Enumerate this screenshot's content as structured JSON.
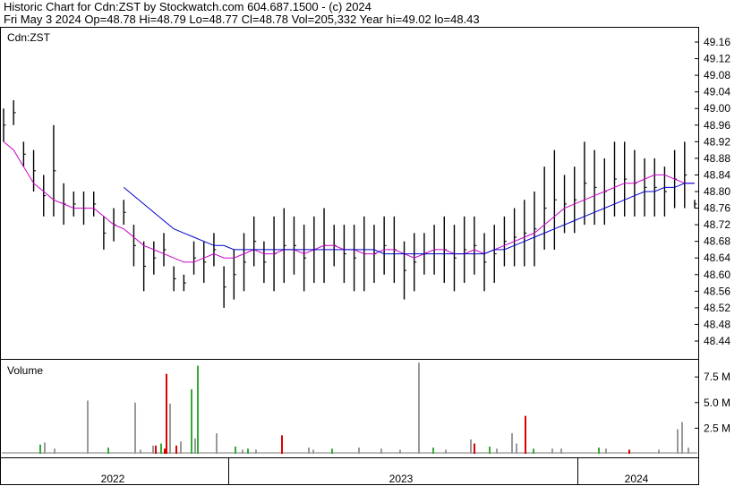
{
  "header": {
    "line1": "Historic Chart for Cdn:ZST by Stockwatch.com 604.687.1500 - (c) 2024",
    "line2": "Fri May  3 2024  Op=48.78  Hi=48.79  Lo=48.77  Cl=48.78  Vol=205,332  Year hi=49.02  lo=48.43"
  },
  "colors": {
    "price_bar": "#000000",
    "ma_short": "#cc00cc",
    "ma_long": "#0000cc",
    "vol_up": "#33aa33",
    "vol_down": "#dd0000",
    "vol_flat": "#999999"
  },
  "chart_data": [
    {
      "type": "ohlc",
      "title": "Cdn:ZST",
      "ylim": [
        48.4,
        49.2
      ],
      "yticks": [
        "49.16",
        "49.12",
        "49.08",
        "49.04",
        "49.00",
        "48.96",
        "48.92",
        "48.88",
        "48.84",
        "48.80",
        "48.76",
        "48.72",
        "48.68",
        "48.64",
        "48.60",
        "48.56",
        "48.52",
        "48.48",
        "48.44"
      ],
      "xticks": [
        "2022",
        "2023",
        "2024"
      ],
      "series": [
        {
          "description": "daily high-low bars",
          "data": [
            [
              48.92,
              49.0
            ],
            [
              48.96,
              49.02
            ],
            [
              48.86,
              48.92
            ],
            [
              48.8,
              48.9
            ],
            [
              48.74,
              48.84
            ],
            [
              48.74,
              48.96
            ],
            [
              48.72,
              48.82
            ],
            [
              48.74,
              48.8
            ],
            [
              48.72,
              48.8
            ],
            [
              48.74,
              48.8
            ],
            [
              48.66,
              48.74
            ],
            [
              48.68,
              48.76
            ],
            [
              48.72,
              48.78
            ],
            [
              48.62,
              48.72
            ],
            [
              48.56,
              48.68
            ],
            [
              48.6,
              48.68
            ],
            [
              48.62,
              48.7
            ],
            [
              48.56,
              48.62
            ],
            [
              48.56,
              48.6
            ],
            [
              48.6,
              48.68
            ],
            [
              48.58,
              48.68
            ],
            [
              48.62,
              48.7
            ],
            [
              48.52,
              48.62
            ],
            [
              48.54,
              48.66
            ],
            [
              48.56,
              48.7
            ],
            [
              48.62,
              48.74
            ],
            [
              48.58,
              48.68
            ],
            [
              48.56,
              48.74
            ],
            [
              48.58,
              48.76
            ],
            [
              48.6,
              48.74
            ],
            [
              48.56,
              48.72
            ],
            [
              48.58,
              48.74
            ],
            [
              48.58,
              48.76
            ],
            [
              48.62,
              48.72
            ],
            [
              48.58,
              48.72
            ],
            [
              48.56,
              48.72
            ],
            [
              48.56,
              48.74
            ],
            [
              48.58,
              48.72
            ],
            [
              48.6,
              48.74
            ],
            [
              48.58,
              48.74
            ],
            [
              48.54,
              48.68
            ],
            [
              48.56,
              48.7
            ],
            [
              48.6,
              48.7
            ],
            [
              48.6,
              48.72
            ],
            [
              48.58,
              48.74
            ],
            [
              48.56,
              48.72
            ],
            [
              48.58,
              48.74
            ],
            [
              48.6,
              48.74
            ],
            [
              48.56,
              48.7
            ],
            [
              48.58,
              48.72
            ],
            [
              48.62,
              48.74
            ],
            [
              48.62,
              48.76
            ],
            [
              48.62,
              48.78
            ],
            [
              48.62,
              48.8
            ],
            [
              48.66,
              48.86
            ],
            [
              48.66,
              48.9
            ],
            [
              48.7,
              48.84
            ],
            [
              48.7,
              48.86
            ],
            [
              48.72,
              48.92
            ],
            [
              48.72,
              48.9
            ],
            [
              48.72,
              48.88
            ],
            [
              48.74,
              48.92
            ],
            [
              48.74,
              48.92
            ],
            [
              48.74,
              48.9
            ],
            [
              48.74,
              48.88
            ],
            [
              48.74,
              48.88
            ],
            [
              48.74,
              48.86
            ],
            [
              48.76,
              48.9
            ],
            [
              48.76,
              48.92
            ],
            [
              48.76,
              48.78
            ]
          ]
        },
        {
          "name": "",
          "description": "short moving average",
          "values": [
            48.92,
            48.9,
            48.86,
            48.82,
            48.8,
            48.78,
            48.77,
            48.76,
            48.76,
            48.76,
            48.74,
            48.72,
            48.71,
            48.69,
            48.67,
            48.66,
            48.65,
            48.64,
            48.63,
            48.63,
            48.64,
            48.65,
            48.64,
            48.64,
            48.65,
            48.66,
            48.65,
            48.65,
            48.66,
            48.66,
            48.65,
            48.66,
            48.67,
            48.67,
            48.66,
            48.66,
            48.65,
            48.65,
            48.66,
            48.66,
            48.65,
            48.64,
            48.65,
            48.66,
            48.66,
            48.65,
            48.65,
            48.66,
            48.65,
            48.66,
            48.67,
            48.68,
            48.69,
            48.7,
            48.72,
            48.74,
            48.76,
            48.77,
            48.78,
            48.79,
            48.8,
            48.81,
            48.82,
            48.82,
            48.83,
            48.84,
            48.84,
            48.83,
            48.82,
            48.82
          ]
        },
        {
          "name": "",
          "description": "long moving average",
          "values": [
            null,
            null,
            null,
            null,
            null,
            null,
            null,
            null,
            null,
            null,
            null,
            null,
            48.81,
            48.79,
            48.77,
            48.75,
            48.73,
            48.71,
            48.7,
            48.69,
            48.68,
            48.67,
            48.67,
            48.66,
            48.66,
            48.66,
            48.66,
            48.66,
            48.66,
            48.66,
            48.66,
            48.66,
            48.66,
            48.66,
            48.66,
            48.66,
            48.66,
            48.66,
            48.65,
            48.65,
            48.65,
            48.65,
            48.65,
            48.65,
            48.65,
            48.65,
            48.65,
            48.65,
            48.65,
            48.66,
            48.66,
            48.67,
            48.68,
            48.69,
            48.7,
            48.71,
            48.72,
            48.73,
            48.74,
            48.75,
            48.76,
            48.77,
            48.78,
            48.79,
            48.8,
            48.8,
            48.81,
            48.81,
            48.82,
            48.82
          ]
        }
      ]
    },
    {
      "type": "bar",
      "title": "Volume",
      "ylim": [
        0,
        9.0
      ],
      "yticks": [
        "7.5 M",
        "5.0 M",
        "2.5 M"
      ],
      "spikes": [
        {
          "x": 44,
          "value": 0.9,
          "dir": "up"
        },
        {
          "x": 49,
          "value": 1.1,
          "dir": "flat"
        },
        {
          "x": 60,
          "value": 0.5,
          "dir": "flat"
        },
        {
          "x": 97,
          "value": 5.2,
          "dir": "flat"
        },
        {
          "x": 120,
          "value": 0.6,
          "dir": "up"
        },
        {
          "x": 150,
          "value": 5.0,
          "dir": "flat"
        },
        {
          "x": 156,
          "value": 0.4,
          "dir": "flat"
        },
        {
          "x": 170,
          "value": 0.8,
          "dir": "flat"
        },
        {
          "x": 173,
          "value": 0.8,
          "dir": "down"
        },
        {
          "x": 179,
          "value": 1.0,
          "dir": "up"
        },
        {
          "x": 183,
          "value": 0.5,
          "dir": "down"
        },
        {
          "x": 185,
          "value": 7.8,
          "dir": "down"
        },
        {
          "x": 189,
          "value": 4.9,
          "dir": "flat"
        },
        {
          "x": 196,
          "value": 0.8,
          "dir": "down"
        },
        {
          "x": 201,
          "value": 1.2,
          "dir": "flat"
        },
        {
          "x": 213,
          "value": 6.3,
          "dir": "up"
        },
        {
          "x": 217,
          "value": 1.5,
          "dir": "flat"
        },
        {
          "x": 220,
          "value": 8.6,
          "dir": "up"
        },
        {
          "x": 241,
          "value": 2.0,
          "dir": "flat"
        },
        {
          "x": 262,
          "value": 0.7,
          "dir": "up"
        },
        {
          "x": 270,
          "value": 0.4,
          "dir": "flat"
        },
        {
          "x": 276,
          "value": 0.5,
          "dir": "up"
        },
        {
          "x": 285,
          "value": 0.4,
          "dir": "flat"
        },
        {
          "x": 314,
          "value": 1.8,
          "dir": "down"
        },
        {
          "x": 344,
          "value": 0.6,
          "dir": "flat"
        },
        {
          "x": 349,
          "value": 0.4,
          "dir": "flat"
        },
        {
          "x": 370,
          "value": 0.5,
          "dir": "up"
        },
        {
          "x": 400,
          "value": 0.6,
          "dir": "flat"
        },
        {
          "x": 425,
          "value": 0.5,
          "dir": "flat"
        },
        {
          "x": 446,
          "value": 0.4,
          "dir": "flat"
        },
        {
          "x": 467,
          "value": 8.9,
          "dir": "flat"
        },
        {
          "x": 483,
          "value": 0.6,
          "dir": "up"
        },
        {
          "x": 497,
          "value": 0.4,
          "dir": "flat"
        },
        {
          "x": 525,
          "value": 1.4,
          "dir": "flat"
        },
        {
          "x": 529,
          "value": 1.0,
          "dir": "down"
        },
        {
          "x": 546,
          "value": 0.7,
          "dir": "up"
        },
        {
          "x": 554,
          "value": 0.5,
          "dir": "flat"
        },
        {
          "x": 571,
          "value": 2.0,
          "dir": "flat"
        },
        {
          "x": 576,
          "value": 1.0,
          "dir": "flat"
        },
        {
          "x": 586,
          "value": 3.7,
          "dir": "down"
        },
        {
          "x": 595,
          "value": 0.5,
          "dir": "up"
        },
        {
          "x": 616,
          "value": 0.5,
          "dir": "flat"
        },
        {
          "x": 626,
          "value": 0.5,
          "dir": "flat"
        },
        {
          "x": 668,
          "value": 0.6,
          "dir": "up"
        },
        {
          "x": 676,
          "value": 0.5,
          "dir": "flat"
        },
        {
          "x": 702,
          "value": 0.4,
          "dir": "down"
        },
        {
          "x": 735,
          "value": 0.4,
          "dir": "flat"
        },
        {
          "x": 756,
          "value": 2.4,
          "dir": "flat"
        },
        {
          "x": 761,
          "value": 3.1,
          "dir": "flat"
        },
        {
          "x": 768,
          "value": 0.6,
          "dir": "flat"
        }
      ]
    }
  ]
}
